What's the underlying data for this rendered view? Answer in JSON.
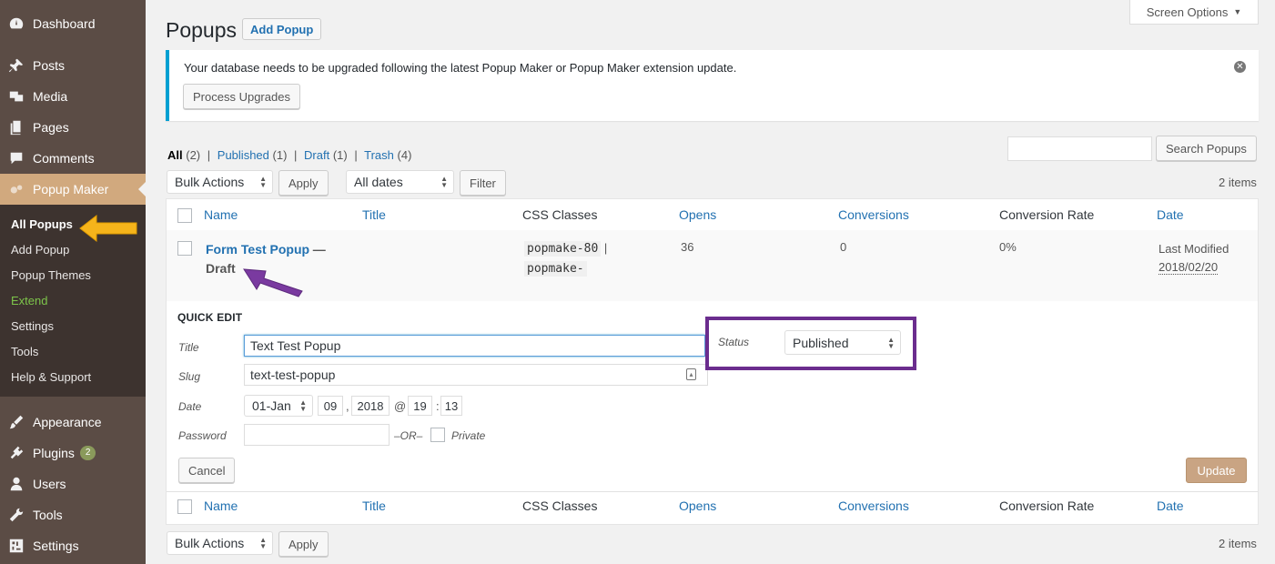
{
  "sidebar": {
    "items": [
      {
        "label": "Dashboard",
        "icon": "dashboard-icon"
      },
      {
        "label": "Posts",
        "icon": "pin-icon"
      },
      {
        "label": "Media",
        "icon": "media-icon"
      },
      {
        "label": "Pages",
        "icon": "pages-icon"
      },
      {
        "label": "Comments",
        "icon": "comment-icon"
      },
      {
        "label": "Popup Maker",
        "icon": "popup-maker-icon"
      },
      {
        "label": "Appearance",
        "icon": "brush-icon"
      },
      {
        "label": "Plugins",
        "icon": "plugin-icon",
        "badge": "2"
      },
      {
        "label": "Users",
        "icon": "user-icon"
      },
      {
        "label": "Tools",
        "icon": "wrench-icon"
      },
      {
        "label": "Settings",
        "icon": "settings-icon"
      }
    ],
    "submenu": [
      "All Popups",
      "Add Popup",
      "Popup Themes",
      "Extend",
      "Settings",
      "Tools",
      "Help & Support"
    ]
  },
  "header": {
    "title": "Popups",
    "add_button": "Add Popup",
    "screen_options": "Screen Options"
  },
  "notice": {
    "text": "Your database needs to be upgraded following the latest Popup Maker or Popup Maker extension update.",
    "button": "Process Upgrades",
    "dismiss": "✕"
  },
  "filters": {
    "all": "All",
    "all_count": "(2)",
    "published": "Published",
    "published_count": "(1)",
    "draft": "Draft",
    "draft_count": "(1)",
    "trash": "Trash",
    "trash_count": "(4)",
    "sep": "|"
  },
  "toolbar": {
    "search_button": "Search Popups",
    "bulk_actions": "Bulk Actions",
    "apply": "Apply",
    "all_dates": "All dates",
    "filter": "Filter",
    "items_count": "2 items"
  },
  "table": {
    "columns": [
      "Name",
      "Title",
      "CSS Classes",
      "Opens",
      "Conversions",
      "Conversion Rate",
      "Date"
    ],
    "row": {
      "name": "Form Test Popup",
      "state": "— Draft",
      "css1": "popmake-80",
      "css_sep": "|",
      "css2": "popmake-",
      "opens": "36",
      "conversions": "0",
      "rate": "0%",
      "date_label": "Last Modified",
      "date_value": "2018/02/20"
    }
  },
  "quick_edit": {
    "heading": "QUICK EDIT",
    "title_label": "Title",
    "title_value": "Text Test Popup",
    "slug_label": "Slug",
    "slug_value": "text-test-popup",
    "date_label": "Date",
    "month": "01-Jan",
    "day": "09",
    "comma": ",",
    "year": "2018",
    "at": "@",
    "hour": "19",
    "colon": ":",
    "minute": "13",
    "password_label": "Password",
    "or": "–OR–",
    "private_label": "Private",
    "status_label": "Status",
    "status_value": "Published",
    "cancel": "Cancel",
    "update": "Update"
  },
  "colors": {
    "sidebar": "#5b4c45",
    "submenu": "#3d332f",
    "active": "#d1a97e",
    "link": "#2271b1",
    "highlight": "#6b2d8e",
    "arrow_yellow": "#f5b41b"
  }
}
